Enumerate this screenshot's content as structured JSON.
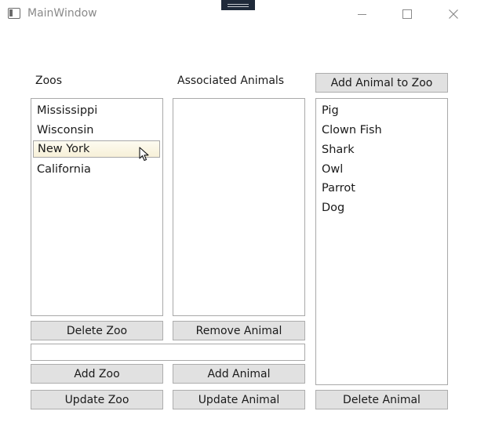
{
  "window": {
    "title": "MainWindow"
  },
  "zoos": {
    "label": "Zoos",
    "items": [
      "Mississippi",
      "Wisconsin",
      "New York",
      "California"
    ],
    "selected": "New York"
  },
  "associated": {
    "label": "Associated Animals",
    "items": []
  },
  "animals": {
    "items": [
      "Pig",
      "Clown Fish",
      "Shark",
      "Owl",
      "Parrot",
      "Dog"
    ]
  },
  "buttons": {
    "add_animal_to_zoo": "Add Animal to Zoo",
    "delete_zoo": "Delete Zoo",
    "remove_animal": "Remove Animal",
    "add_zoo": "Add Zoo",
    "add_animal": "Add Animal",
    "update_zoo": "Update Zoo",
    "update_animal": "Update Animal",
    "delete_animal": "Delete Animal"
  },
  "input": {
    "value": ""
  }
}
